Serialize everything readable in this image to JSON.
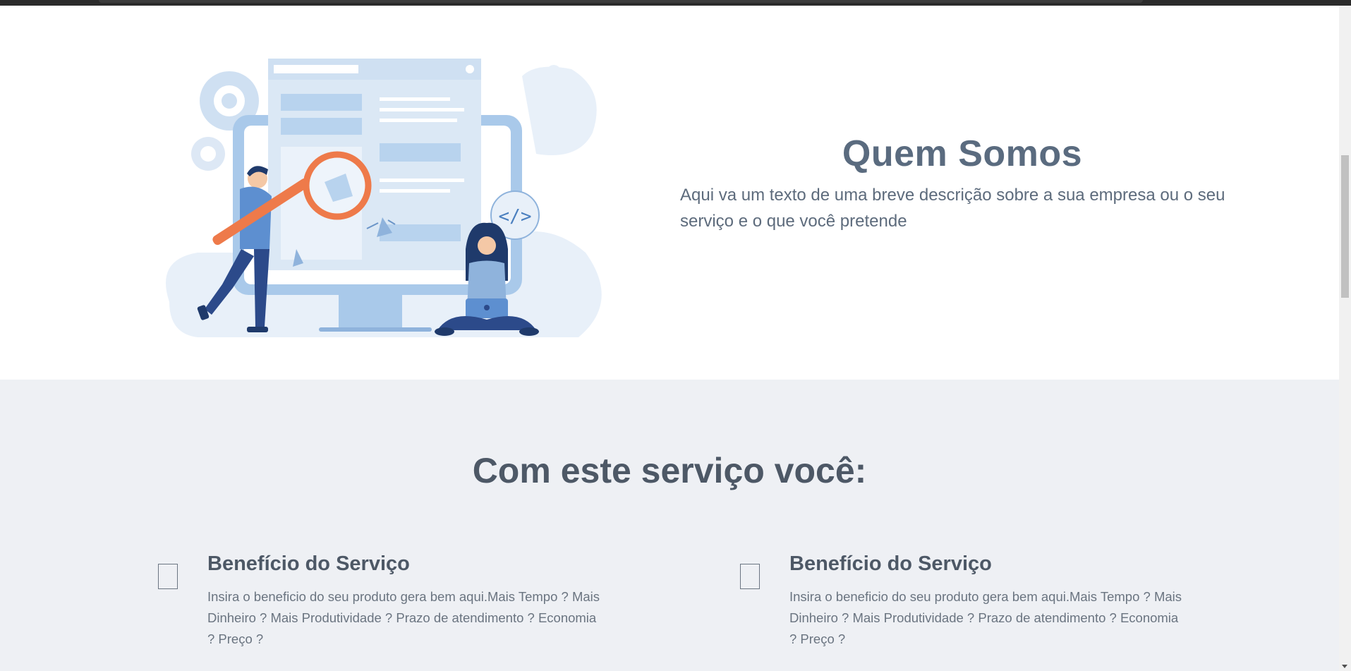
{
  "about": {
    "title": "Quem Somos",
    "description": "Aqui va um texto de uma breve descrição sobre a sua empresa ou o seu serviço e o que você pretende",
    "illustration_code_tag": "</>"
  },
  "benefits": {
    "title": "Com este serviço você:",
    "items": [
      {
        "title": "Benefício do Serviço",
        "description": "Insira o beneficio do seu produto gera bem aqui.Mais Tempo ? Mais Dinheiro ? Mais Produtividade ? Prazo de atendimento ? Economia ? Preço ?"
      },
      {
        "title": "Benefício do Serviço",
        "description": "Insira o beneficio do seu produto gera bem aqui.Mais Tempo ? Mais Dinheiro ? Mais Produtividade ? Prazo de atendimento ? Economia ? Preço ?"
      }
    ]
  },
  "colors": {
    "heading": "#5a6b7f",
    "section_bg": "#eef0f4",
    "illustration_blue": "#a9c9ea",
    "illustration_orange": "#ee7a4a"
  },
  "scrollbar": {
    "position_fraction": 0.22
  }
}
